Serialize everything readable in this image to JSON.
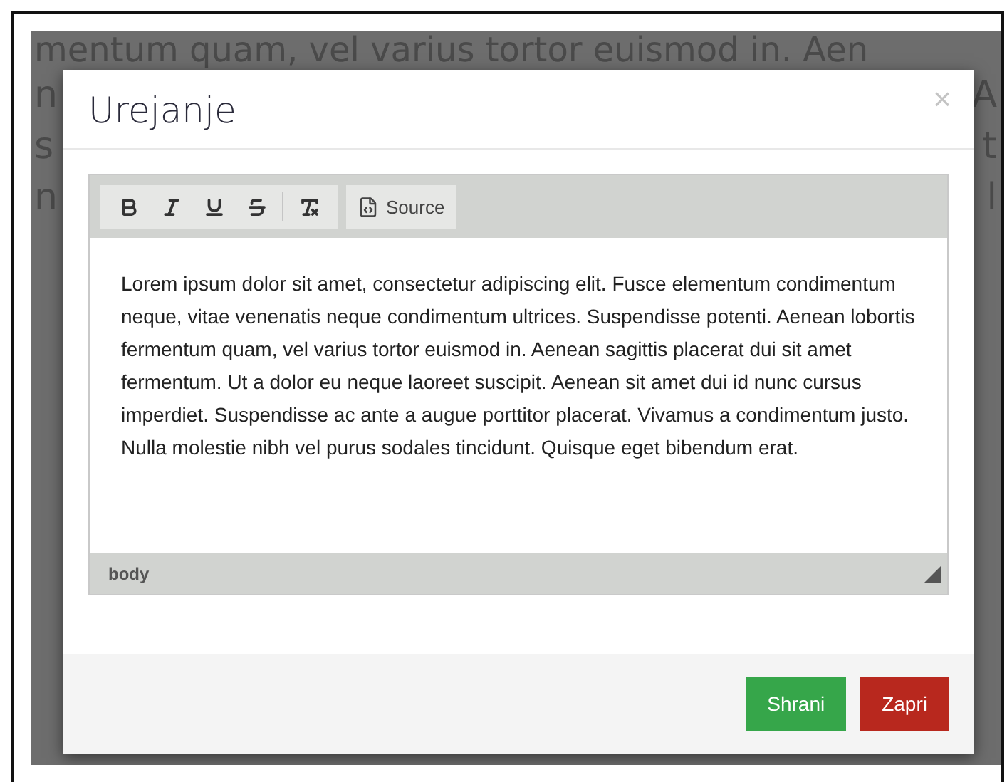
{
  "background": {
    "top_line": "mentum quam, vel varius tortor euismod in. Aen",
    "rows": [
      {
        "left": "n",
        "right": "A"
      },
      {
        "left": "s",
        "right": "t"
      },
      {
        "left": "n",
        "right": "l"
      }
    ]
  },
  "modal": {
    "title": "Urejanje",
    "close": "×",
    "toolbar": {
      "format_buttons": [
        {
          "kind": "bold"
        },
        {
          "kind": "italic"
        },
        {
          "kind": "underline"
        },
        {
          "kind": "strike"
        },
        {
          "kind": "remove_format"
        }
      ],
      "source_button": {
        "label": "Source"
      }
    },
    "content": "Lorem ipsum dolor sit amet, consectetur adipiscing elit. Fusce elementum condimentum neque, vitae venenatis neque condimentum ultrices. Suspendisse potenti. Aenean lobortis fermentum quam, vel varius tortor euismod in. Aenean sagittis placerat dui sit amet fermentum. Ut a dolor eu neque laoreet suscipit. Aenean sit amet dui id nunc cursus imperdiet. Suspendisse ac ante a augue porttitor placerat. Vivamus a condimentum justo. Nulla molestie nibh vel purus sodales tincidunt. Quisque eget bibendum erat.",
    "status_path": "body",
    "buttons": [
      {
        "label": "Shrani",
        "kind": "primary"
      },
      {
        "label": "Zapri",
        "kind": "danger"
      }
    ]
  }
}
